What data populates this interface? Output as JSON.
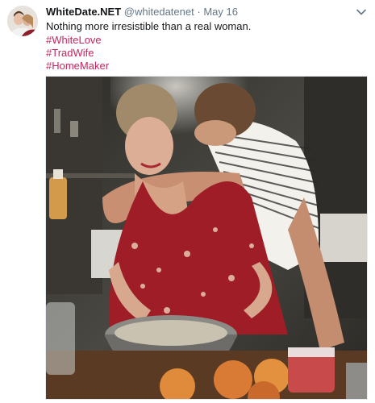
{
  "tweet": {
    "display_name": "WhiteDate.NET",
    "handle": "@whitedatenet",
    "separator": "·",
    "date": "May 16",
    "text": "Nothing more irresistible than a real woman.",
    "hashtags": [
      "#WhiteLove",
      "#TradWife",
      "#HomeMaker"
    ]
  },
  "icons": {
    "avatar": "avatar-photo",
    "menu": "chevron-down-icon"
  },
  "colors": {
    "name": "#14171a",
    "meta": "#657786",
    "hashtag": "#c8255a"
  },
  "media": {
    "subject": "photo-couple-embracing-in-kitchen"
  }
}
